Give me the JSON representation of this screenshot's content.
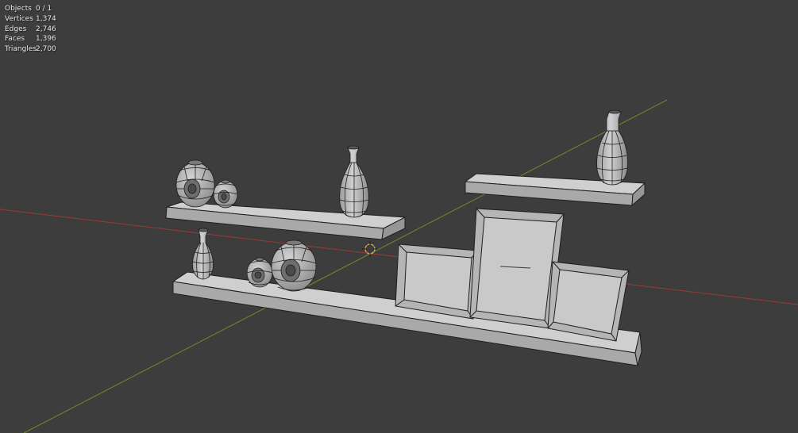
{
  "viewport": {
    "background_color": "#3d3d3d",
    "x_axis_color": "#9a3a3a",
    "y_axis_color": "#6c8c28",
    "mesh_color": "#c4c4c4",
    "wire_color": "#1e1e1e",
    "cursor_color": "#e6a040"
  },
  "stats": {
    "objects": {
      "label": "Objects",
      "value": "0 / 1"
    },
    "vertices": {
      "label": "Vertices",
      "value": "1,374"
    },
    "edges": {
      "label": "Edges",
      "value": "2,746"
    },
    "faces": {
      "label": "Faces",
      "value": "1,396"
    },
    "triangles": {
      "label": "Triangles",
      "value": "2,700"
    }
  },
  "scene_objects": [
    "wall-shelf-top-left",
    "wall-shelf-top-right",
    "floor-shelf-bottom",
    "vase-tall-top",
    "vase-tall-right",
    "vase-small-bottom",
    "round-vase-large-top",
    "round-vase-small-top",
    "round-vase-small-bottom",
    "round-vase-large-bottom",
    "picture-frame-left",
    "picture-frame-center",
    "picture-frame-right",
    "3d-cursor"
  ]
}
